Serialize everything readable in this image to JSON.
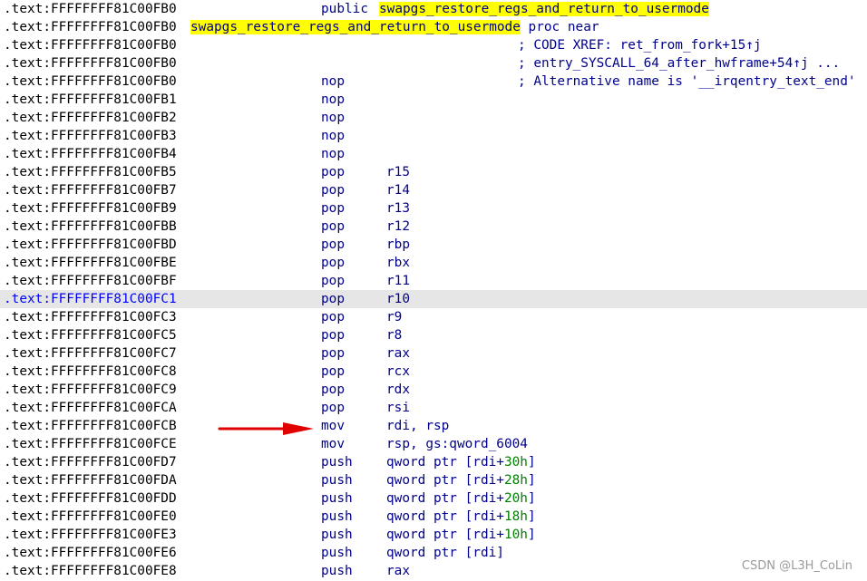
{
  "header": {
    "public_addr": ".text:FFFFFFFF81C00FB0",
    "public_kw": "public",
    "public_sym": "swapgs_restore_regs_and_return_to_usermode",
    "label_addr": ".text:FFFFFFFF81C00FB0",
    "label_sym": "swapgs_restore_regs_and_return_to_usermode",
    "label_tail": " proc near",
    "xref1_addr": ".text:FFFFFFFF81C00FB0",
    "xref1": "; CODE XREF: ret_from_fork+15↑j",
    "xref2_addr": ".text:FFFFFFFF81C00FB0",
    "xref2": "; entry_SYSCALL_64_after_hwframe+54↑j ...",
    "first_addr": ".text:FFFFFFFF81C00FB0",
    "first_mn": "nop",
    "first_comment": "; Alternative name is '__irqentry_text_end'"
  },
  "instructions": [
    {
      "addr": ".text:FFFFFFFF81C00FB1",
      "mn": "nop"
    },
    {
      "addr": ".text:FFFFFFFF81C00FB2",
      "mn": "nop"
    },
    {
      "addr": ".text:FFFFFFFF81C00FB3",
      "mn": "nop"
    },
    {
      "addr": ".text:FFFFFFFF81C00FB4",
      "mn": "nop"
    },
    {
      "addr": ".text:FFFFFFFF81C00FB5",
      "mn": "pop",
      "ops": [
        {
          "t": "r15"
        }
      ]
    },
    {
      "addr": ".text:FFFFFFFF81C00FB7",
      "mn": "pop",
      "ops": [
        {
          "t": "r14"
        }
      ]
    },
    {
      "addr": ".text:FFFFFFFF81C00FB9",
      "mn": "pop",
      "ops": [
        {
          "t": "r13"
        }
      ]
    },
    {
      "addr": ".text:FFFFFFFF81C00FBB",
      "mn": "pop",
      "ops": [
        {
          "t": "r12"
        }
      ]
    },
    {
      "addr": ".text:FFFFFFFF81C00FBD",
      "mn": "pop",
      "ops": [
        {
          "t": "rbp"
        }
      ]
    },
    {
      "addr": ".text:FFFFFFFF81C00FBE",
      "mn": "pop",
      "ops": [
        {
          "t": "rbx"
        }
      ]
    },
    {
      "addr": ".text:FFFFFFFF81C00FBF",
      "mn": "pop",
      "ops": [
        {
          "t": "r11"
        }
      ]
    },
    {
      "addr": ".text:FFFFFFFF81C00FC1",
      "mn": "pop",
      "ops": [
        {
          "t": "r10"
        }
      ],
      "selected": true
    },
    {
      "addr": ".text:FFFFFFFF81C00FC3",
      "mn": "pop",
      "ops": [
        {
          "t": "r9"
        }
      ]
    },
    {
      "addr": ".text:FFFFFFFF81C00FC5",
      "mn": "pop",
      "ops": [
        {
          "t": "r8"
        }
      ]
    },
    {
      "addr": ".text:FFFFFFFF81C00FC7",
      "mn": "pop",
      "ops": [
        {
          "t": "rax"
        }
      ]
    },
    {
      "addr": ".text:FFFFFFFF81C00FC8",
      "mn": "pop",
      "ops": [
        {
          "t": "rcx"
        }
      ]
    },
    {
      "addr": ".text:FFFFFFFF81C00FC9",
      "mn": "pop",
      "ops": [
        {
          "t": "rdx"
        }
      ]
    },
    {
      "addr": ".text:FFFFFFFF81C00FCA",
      "mn": "pop",
      "ops": [
        {
          "t": "rsi"
        }
      ]
    },
    {
      "addr": ".text:FFFFFFFF81C00FCB",
      "mn": "mov",
      "ops": [
        {
          "t": "rdi, rsp"
        }
      ],
      "arrow": true
    },
    {
      "addr": ".text:FFFFFFFF81C00FCE",
      "mn": "mov",
      "ops": [
        {
          "t": "rsp, gs:qword_6004"
        }
      ]
    },
    {
      "addr": ".text:FFFFFFFF81C00FD7",
      "mn": "push",
      "ops": [
        {
          "t": "qword ptr [rdi+"
        },
        {
          "t": "30h",
          "num": true
        },
        {
          "t": "]"
        }
      ]
    },
    {
      "addr": ".text:FFFFFFFF81C00FDA",
      "mn": "push",
      "ops": [
        {
          "t": "qword ptr [rdi+"
        },
        {
          "t": "28h",
          "num": true
        },
        {
          "t": "]"
        }
      ]
    },
    {
      "addr": ".text:FFFFFFFF81C00FDD",
      "mn": "push",
      "ops": [
        {
          "t": "qword ptr [rdi+"
        },
        {
          "t": "20h",
          "num": true
        },
        {
          "t": "]"
        }
      ]
    },
    {
      "addr": ".text:FFFFFFFF81C00FE0",
      "mn": "push",
      "ops": [
        {
          "t": "qword ptr [rdi+"
        },
        {
          "t": "18h",
          "num": true
        },
        {
          "t": "]"
        }
      ]
    },
    {
      "addr": ".text:FFFFFFFF81C00FE3",
      "mn": "push",
      "ops": [
        {
          "t": "qword ptr [rdi+"
        },
        {
          "t": "10h",
          "num": true
        },
        {
          "t": "]"
        }
      ]
    },
    {
      "addr": ".text:FFFFFFFF81C00FE6",
      "mn": "push",
      "ops": [
        {
          "t": "qword ptr [rdi]"
        }
      ]
    },
    {
      "addr": ".text:FFFFFFFF81C00FE8",
      "mn": "push",
      "ops": [
        {
          "t": "rax"
        }
      ]
    }
  ],
  "colors": {
    "background": "#ffffff",
    "selected_row": "#e6e6e6",
    "symbol_highlight": "#ffff00",
    "code": "#00008b",
    "number": "#008000",
    "arrow": "#e00000"
  },
  "watermark": "CSDN @L3H_CoLin"
}
